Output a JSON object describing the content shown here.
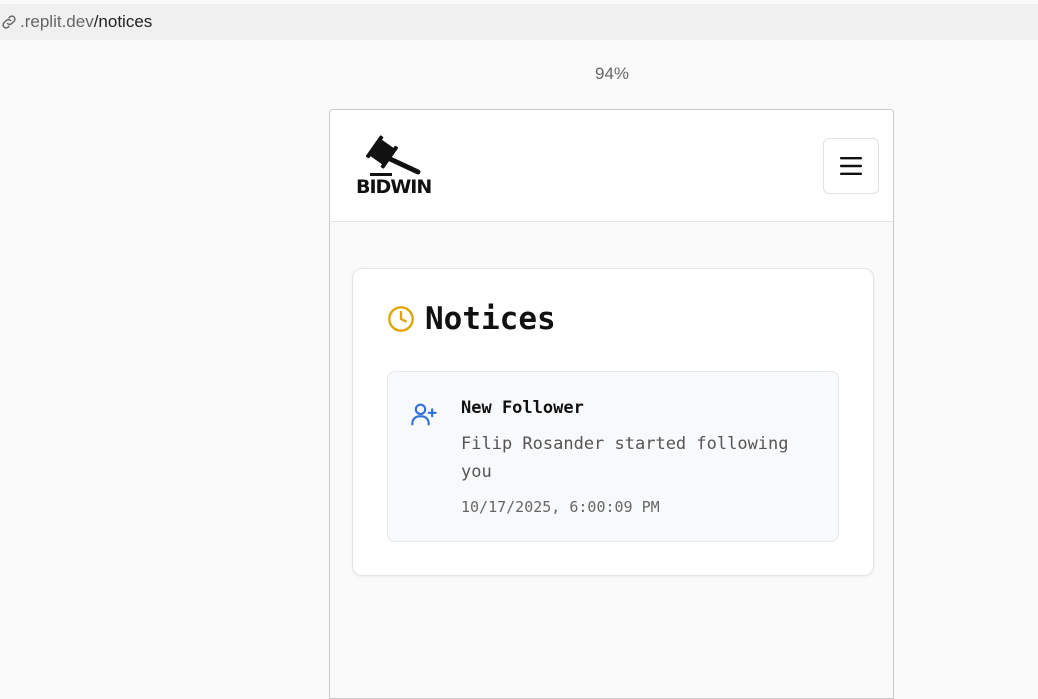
{
  "browser": {
    "url_domain": ".replit.dev",
    "url_path": "/notices",
    "zoom": "94%"
  },
  "header": {
    "logo_text": "BIDWIN",
    "menu_icon": "hamburger-icon"
  },
  "notices": {
    "title": "Notices",
    "title_icon": "clock-icon",
    "accent_color": "#e0a500",
    "items": [
      {
        "icon": "user-plus-icon",
        "icon_color": "#2f6fde",
        "title": "New Follower",
        "body": "Filip Rosander started following you",
        "timestamp": "10/17/2025, 6:00:09 PM"
      }
    ]
  }
}
